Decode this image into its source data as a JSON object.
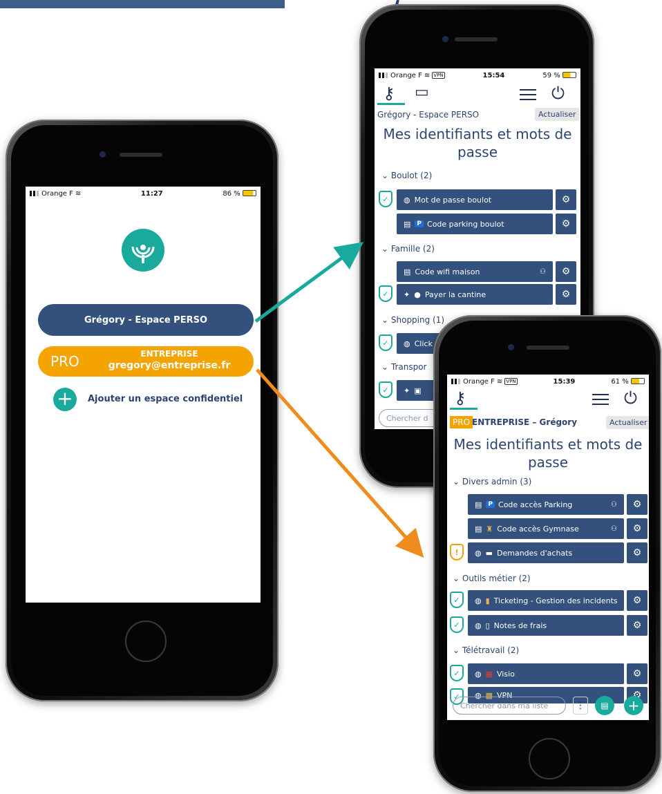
{
  "phone1": {
    "status": {
      "carrier": "Orange F",
      "time": "11:27",
      "battery": "86 %"
    },
    "perso_button": "Grégory - Espace PERSO",
    "pro_button": {
      "badge": "PRO",
      "line1": "ENTREPRISE",
      "line2": "gregory@entreprise.fr"
    },
    "add_plus": "+",
    "add_label": "Ajouter un espace confidentiel"
  },
  "phone2": {
    "status": {
      "carrier": "Orange F",
      "vpn": "VPN",
      "time": "15:54",
      "battery": "59 %"
    },
    "space_name": "Grégory - Espace PERSO",
    "refresh": "Actualiser",
    "title_line1": "Mes identifiants et mots de",
    "title_line2": "passe",
    "groups": [
      {
        "label": "Boulot (2)"
      },
      {
        "label": "Famille (2)"
      },
      {
        "label": "Shopping (1)"
      },
      {
        "label": "Transpor"
      }
    ],
    "items": [
      {
        "label": "Mot de passe boulot"
      },
      {
        "label": "Code parking boulot",
        "badge": "P"
      },
      {
        "label": "Code wifi maison"
      },
      {
        "label": "Payer la cantine"
      },
      {
        "label": "Click"
      }
    ],
    "search_placeholder": "Chercher d"
  },
  "phone3": {
    "status": {
      "carrier": "Orange F",
      "vpn": "VPN",
      "time": "15:39",
      "battery": "61 %"
    },
    "pro_tag": "PRO",
    "space_name": "ENTREPRISE – Grégory",
    "refresh": "Actualiser",
    "title_line1": "Mes identifiants et mots de",
    "title_line2": "passe",
    "groups": [
      {
        "label": "Divers admin (3)"
      },
      {
        "label": "Outils métier  (2)"
      },
      {
        "label": "Télétravail (2)"
      }
    ],
    "items": [
      {
        "label": "Code accès Parking",
        "badge": "P"
      },
      {
        "label": "Code accès Gymnase"
      },
      {
        "label": "Demandes d'achats"
      },
      {
        "label": "Ticketing - Gestion des incidents"
      },
      {
        "label": "Notes de frais"
      },
      {
        "label": "Visio"
      },
      {
        "label": "VPN"
      }
    ],
    "warn_mark": "!",
    "search_placeholder": "Chercher dans ma liste",
    "menu_dots": "⋮",
    "add_plus": "+"
  },
  "colors": {
    "navy": "#34507c",
    "teal": "#1aa99d",
    "orange": "#f4a300",
    "arrow_teal": "#1aa99d",
    "arrow_orange": "#f08c1e"
  }
}
